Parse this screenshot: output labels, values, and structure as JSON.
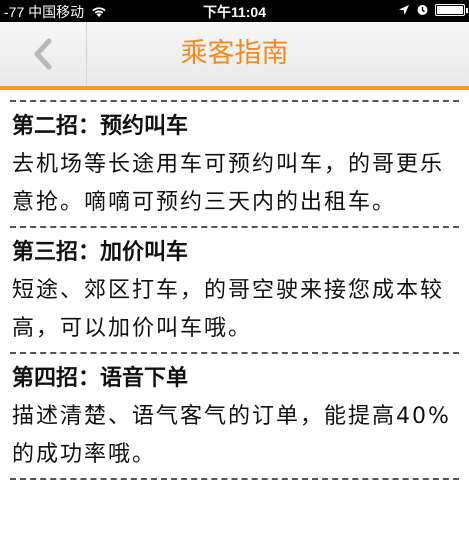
{
  "status_bar": {
    "carrier": "-77 中国移动",
    "time": "下午11:04"
  },
  "nav": {
    "title": "乘客指南"
  },
  "sections": [
    {
      "title": "第二招：预约叫车",
      "body": "去机场等长途用车可预约叫车，的哥更乐意抢。嘀嘀可预约三天内的出租车。"
    },
    {
      "title": "第三招：加价叫车",
      "body": "短途、郊区打车，的哥空驶来接您成本较高，可以加价叫车哦。"
    },
    {
      "title": "第四招：语音下单",
      "body": "描述清楚、语气客气的订单，能提高40%的成功率哦。"
    }
  ],
  "icons": [
    "wifi-icon",
    "location-arrow-icon",
    "alarm-icon",
    "battery-icon",
    "chevron-left-icon"
  ],
  "colors": {
    "accent": "#f18b1d",
    "accent_border": "#f39c27"
  }
}
